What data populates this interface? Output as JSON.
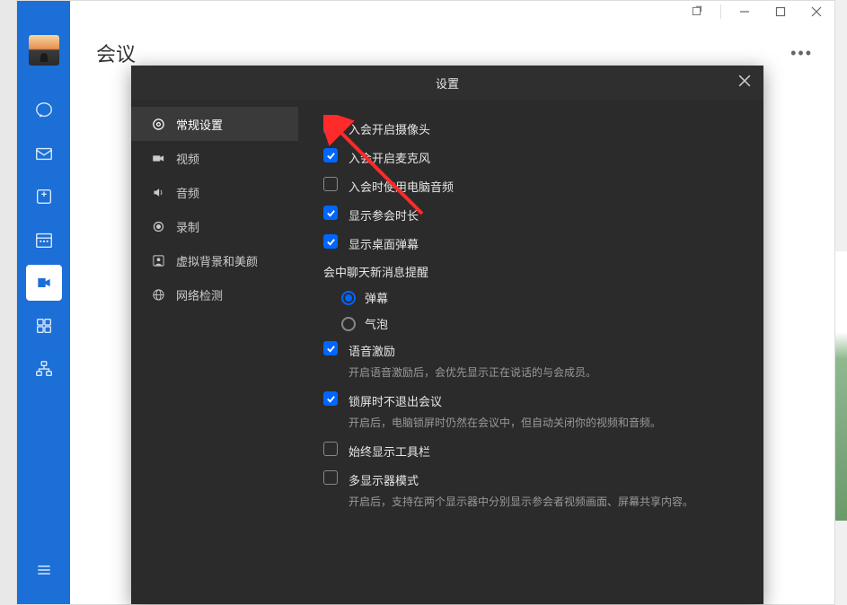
{
  "window": {
    "title": "会议"
  },
  "modal": {
    "title": "设置"
  },
  "settingsSidebar": {
    "items": [
      {
        "label": "常规设置",
        "icon": "gear"
      },
      {
        "label": "视频",
        "icon": "video"
      },
      {
        "label": "音频",
        "icon": "audio"
      },
      {
        "label": "录制",
        "icon": "record"
      },
      {
        "label": "虚拟背景和美颜",
        "icon": "portrait"
      },
      {
        "label": "网络检测",
        "icon": "network"
      }
    ]
  },
  "options": {
    "openCamera": {
      "label": "入会开启摄像头",
      "checked": true
    },
    "openMic": {
      "label": "入会开启麦克风",
      "checked": true
    },
    "useComputerAudio": {
      "label": "入会时使用电脑音频",
      "checked": false
    },
    "showDuration": {
      "label": "显示参会时长",
      "checked": true
    },
    "showDesktopDanmu": {
      "label": "显示桌面弹幕",
      "checked": true
    },
    "chatReminderSection": "会中聊天新消息提醒",
    "chatReminder": {
      "danmu": "弹幕",
      "bubble": "气泡",
      "selected": "danmu"
    },
    "voiceActivation": {
      "label": "语音激励",
      "checked": true,
      "desc": "开启语音激励后，会优先显示正在说话的与会成员。"
    },
    "lockscreenStay": {
      "label": "锁屏时不退出会议",
      "checked": true,
      "desc": "开启后，电脑锁屏时仍然在会议中，但自动关闭你的视频和音频。"
    },
    "alwaysToolbar": {
      "label": "始终显示工具栏",
      "checked": false
    },
    "multiMonitor": {
      "label": "多显示器模式",
      "checked": false,
      "desc": "开启后，支持在两个显示器中分别显示参会者视频画面、屏幕共享内容。"
    }
  }
}
